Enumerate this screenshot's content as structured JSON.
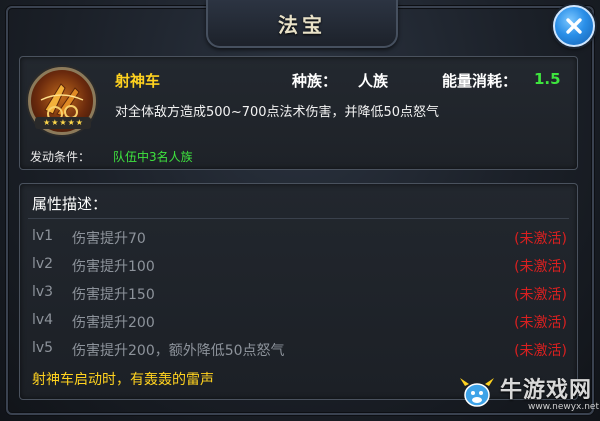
{
  "window": {
    "title": "法宝"
  },
  "close_button": {
    "icon": "close-icon"
  },
  "item": {
    "icon": "chariot-icon",
    "stars": [
      "★",
      "★",
      "★",
      "★",
      "★"
    ],
    "name": "射神车",
    "race_label": "种族：",
    "race_value": "人族",
    "energy_label": "能量消耗：",
    "energy_value": "1.5",
    "description": "对全体敌方造成500~700点法术伤害，并降低50点怒气",
    "condition_label": "发动条件：",
    "condition_value": "队伍中3名人族"
  },
  "attributes": {
    "title": "属性描述：",
    "rows": [
      {
        "level": "lv1",
        "text": "伤害提升70",
        "status": "(未激活)"
      },
      {
        "level": "lv2",
        "text": "伤害提升100",
        "status": "(未激活)"
      },
      {
        "level": "lv3",
        "text": "伤害提升150",
        "status": "(未激活)"
      },
      {
        "level": "lv4",
        "text": "伤害提升200",
        "status": "(未激活)"
      },
      {
        "level": "lv5",
        "text": "伤害提升200，额外降低50点怒气",
        "status": "(未激活)"
      }
    ],
    "flavor": "射神车启动时，有轰轰的雷声"
  },
  "watermark": {
    "text": "牛游戏网",
    "url": "www.newyx.net"
  },
  "colors": {
    "name": "#ffd21f",
    "green": "#3ee43e",
    "inactive": "#d92020",
    "accent_blue": "#2a8fe8"
  }
}
